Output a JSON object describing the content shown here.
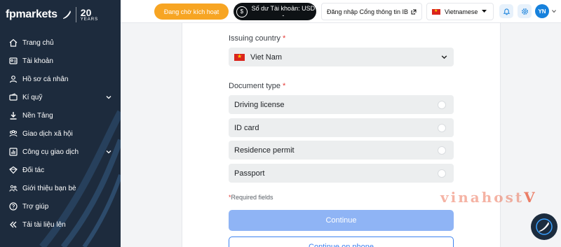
{
  "brand": {
    "logo_text": "fpmarkets",
    "years_number": "20",
    "years_label": "YEARS"
  },
  "sidebar": {
    "items": [
      {
        "label": "Trang chủ",
        "icon": "home-icon",
        "has_chevron": false
      },
      {
        "label": "Tài khoản",
        "icon": "accounts-icon",
        "has_chevron": false
      },
      {
        "label": "Hồ sơ cá nhân",
        "icon": "profile-icon",
        "has_chevron": false
      },
      {
        "label": "Kí quỹ",
        "icon": "wallet-icon",
        "has_chevron": true
      },
      {
        "label": "Nền Tảng",
        "icon": "download-icon",
        "has_chevron": false
      },
      {
        "label": "Giao dịch xã hội",
        "icon": "social-trading-icon",
        "has_chevron": false
      },
      {
        "label": "Công cụ giao dịch",
        "icon": "tools-icon",
        "has_chevron": true
      },
      {
        "label": "Đối tác",
        "icon": "partner-icon",
        "has_chevron": false
      },
      {
        "label": "Giới thiệu bạn bè",
        "icon": "refer-friends-icon",
        "has_chevron": false
      },
      {
        "label": "Trợ giúp",
        "icon": "help-icon",
        "has_chevron": false
      },
      {
        "label": "Tải tài liệu lên",
        "icon": "collapse-icon",
        "has_chevron": false
      }
    ]
  },
  "topbar": {
    "activate_label": "Đang chờ kích hoạt",
    "balance_label": "Số dư Tài khoản: USD -",
    "ib_login_label": "Đăng nhập Cổng thông tin IB",
    "language_label": "Vietnamese",
    "avatar_initials": "YN"
  },
  "form": {
    "issuing_country_label": "Issuing country",
    "issuing_country_value": "Viet Nam",
    "document_type_label": "Document type",
    "required_marker": "*",
    "document_options": [
      "Driving license",
      "ID card",
      "Residence permit",
      "Passport"
    ],
    "required_note": "Required fields",
    "continue_label": "Continue",
    "continue_phone_label": "Continue on phone"
  },
  "watermark": {
    "text": "vinahost",
    "suffix": "V"
  },
  "colors": {
    "sidebar_bg": "#1d2b3d",
    "activate_bg": "#f7a523",
    "balance_bg": "#0e1215",
    "continue_bg": "#8fb4f5",
    "accent_blue": "#3c82f0",
    "required_red": "#e53935"
  }
}
